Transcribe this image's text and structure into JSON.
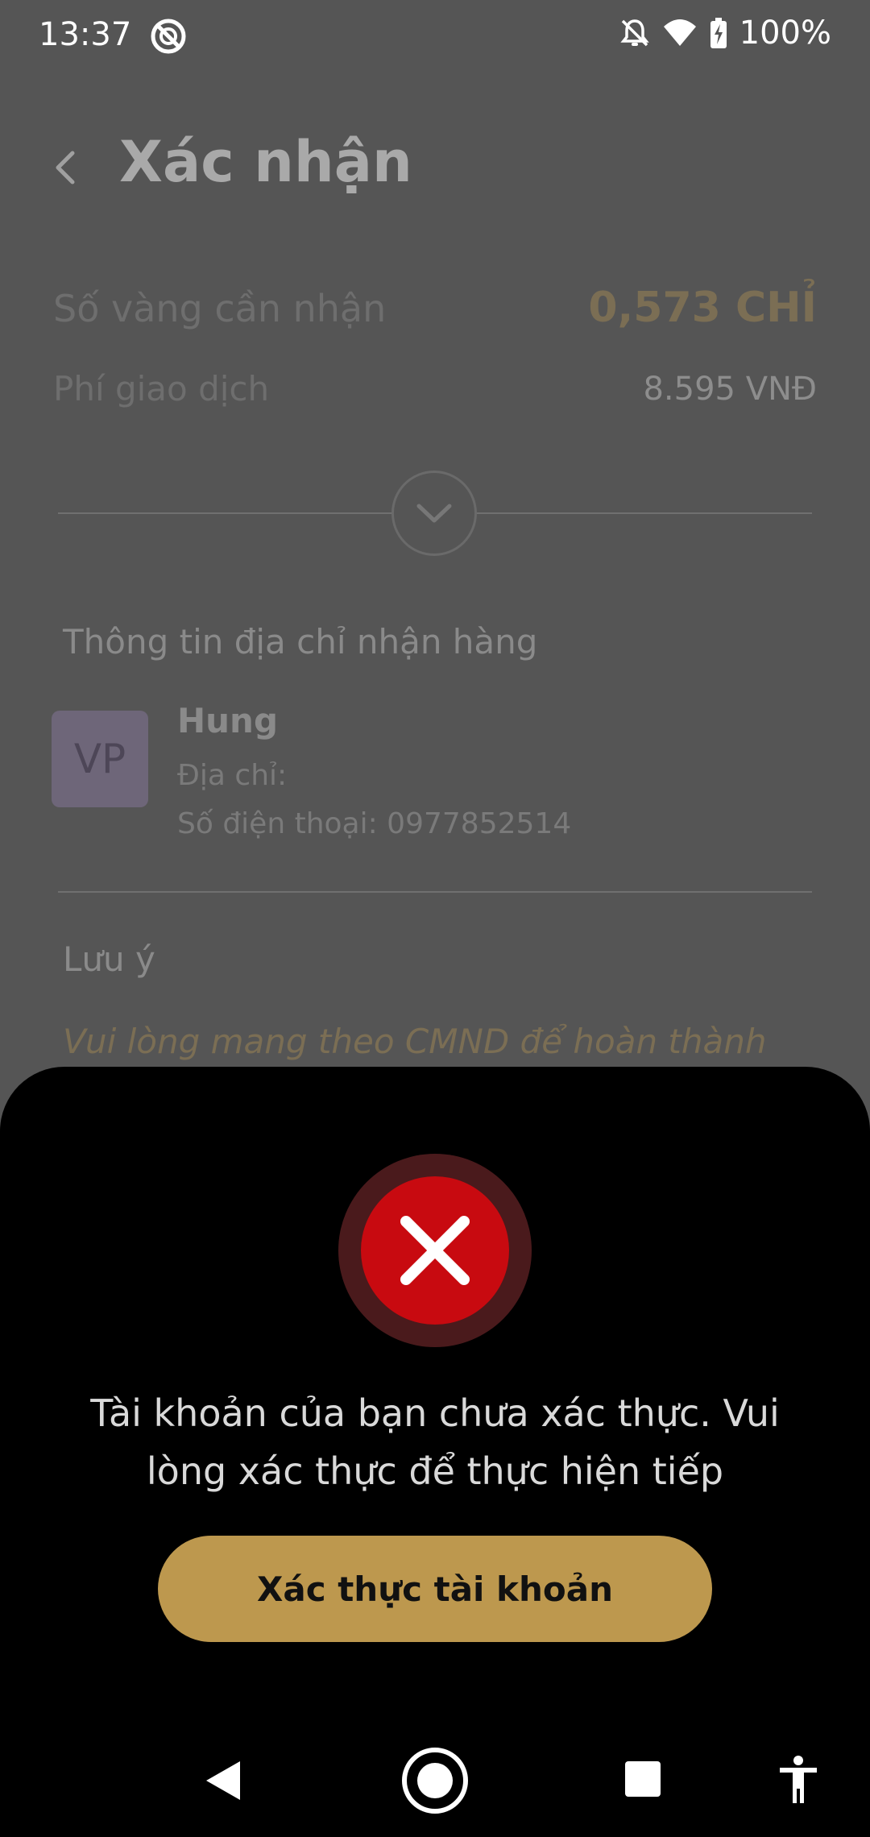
{
  "status_bar": {
    "time": "13:37",
    "battery": "100%",
    "icons": [
      "app-notification-icon",
      "bell-off-icon",
      "wifi-icon",
      "battery-charging-icon"
    ]
  },
  "header": {
    "title": "Xác nhận"
  },
  "summary": {
    "gold_label": "Số vàng cần nhận",
    "gold_value": "0,573 CHỈ",
    "fee_label": "Phí giao dịch",
    "fee_value": "8.595 VNĐ"
  },
  "address": {
    "section_title": "Thông tin địa chỉ nhận hàng",
    "avatar_initials": "VP",
    "name": "Hung",
    "address_label": "Địa chỉ:",
    "phone_text": "Số điện thoại: 0977852514"
  },
  "note": {
    "title": "Lưu ý",
    "text": "Vui lòng mang theo CMND để hoàn thành"
  },
  "dialog": {
    "message": "Tài khoản của bạn chưa xác thực. Vui lòng xác thực để thực hiện tiếp",
    "button_label": "Xác thực tài khoản"
  },
  "colors": {
    "accent_gold": "#bd984e",
    "error_red": "#c80a10",
    "error_ring": "#4a1a1c",
    "sheet_bg": "#000000",
    "overlay_bg": "#555555"
  }
}
